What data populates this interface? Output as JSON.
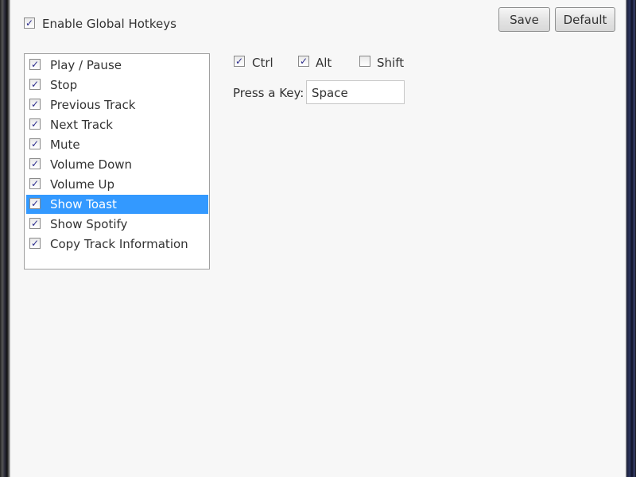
{
  "enable_global_hotkeys": {
    "label": "Enable Global Hotkeys",
    "checked": true
  },
  "buttons": {
    "save": "Save",
    "default": "Default"
  },
  "hotkey_list": [
    {
      "label": "Play / Pause",
      "checked": true
    },
    {
      "label": "Stop",
      "checked": true
    },
    {
      "label": "Previous Track",
      "checked": true
    },
    {
      "label": "Next Track",
      "checked": true
    },
    {
      "label": "Mute",
      "checked": true
    },
    {
      "label": "Volume Down",
      "checked": true
    },
    {
      "label": "Volume Up",
      "checked": true
    },
    {
      "label": "Show Toast",
      "checked": true,
      "selected": true
    },
    {
      "label": "Show Spotify",
      "checked": true
    },
    {
      "label": "Copy Track Information",
      "checked": true
    }
  ],
  "modifiers": {
    "ctrl": {
      "label": "Ctrl",
      "checked": true
    },
    "alt": {
      "label": "Alt",
      "checked": true
    },
    "shift": {
      "label": "Shift",
      "checked": false
    }
  },
  "key": {
    "label": "Press a Key:",
    "value": "Space"
  },
  "colors": {
    "selection": "#3399ff",
    "check": "#2b2b8c"
  }
}
